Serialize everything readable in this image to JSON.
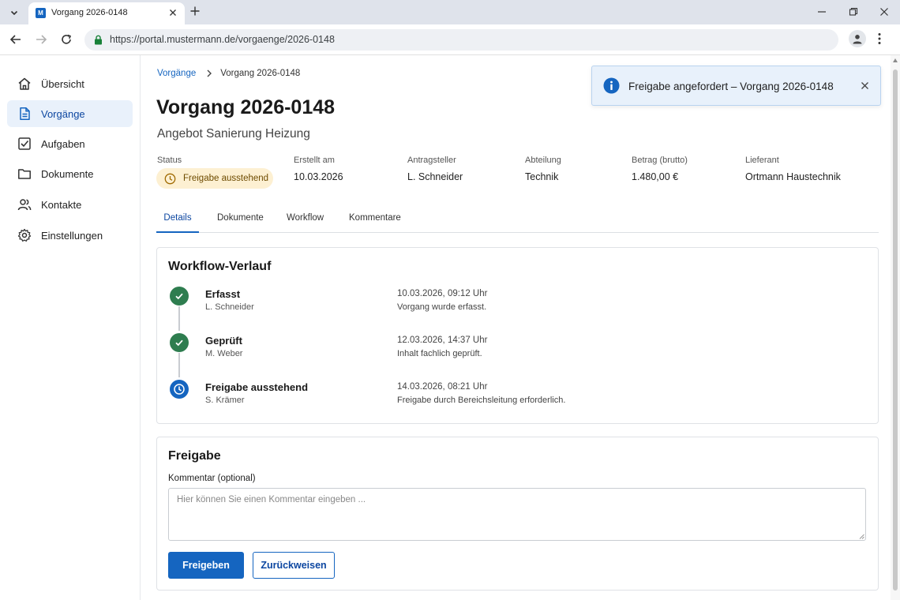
{
  "browser": {
    "tab_title": "Vorgang 2026-0148",
    "favicon_text": "M",
    "url": "https://portal.mustermann.de/vorgaenge/2026-0148"
  },
  "sidebar": {
    "items": [
      {
        "label": "Übersicht",
        "icon": "home-icon"
      },
      {
        "label": "Vorgänge",
        "icon": "document-icon",
        "active": true
      },
      {
        "label": "Aufgaben",
        "icon": "checkbox-icon"
      },
      {
        "label": "Dokumente",
        "icon": "folder-icon"
      },
      {
        "label": "Kontakte",
        "icon": "contacts-icon"
      },
      {
        "label": "Einstellungen",
        "icon": "gear-icon"
      }
    ]
  },
  "breadcrumb": {
    "parent": "Vorgänge",
    "current": "Vorgang 2026-0148"
  },
  "header": {
    "title": "Vorgang 2026-0148",
    "subtitle": "Angebot Sanierung Heizung"
  },
  "meta": {
    "status_label": "Status",
    "status_value": "Freigabe ausstehend",
    "created_label": "Erstellt am",
    "created_value": "10.03.2026",
    "applicant_label": "Antragsteller",
    "applicant_value": "L. Schneider",
    "department_label": "Abteilung",
    "department_value": "Technik",
    "amount_label": "Betrag (brutto)",
    "amount_value": "1.480,00 €",
    "supplier_label": "Lieferant",
    "supplier_value": "Ortmann Haustechnik"
  },
  "tabs": [
    {
      "label": "Details",
      "active": true
    },
    {
      "label": "Dokumente"
    },
    {
      "label": "Workflow"
    },
    {
      "label": "Kommentare"
    }
  ],
  "workflow": {
    "title": "Workflow-Verlauf",
    "steps": [
      {
        "name": "Erfasst",
        "person": "L. Schneider",
        "timestamp": "10.03.2026, 09:12 Uhr",
        "note": "Vorgang wurde erfasst.",
        "state": "done"
      },
      {
        "name": "Geprüft",
        "person": "M. Weber",
        "timestamp": "12.03.2026, 14:37 Uhr",
        "note": "Inhalt fachlich geprüft.",
        "state": "done"
      },
      {
        "name": "Freigabe ausstehend",
        "person": "S. Krämer",
        "timestamp": "14.03.2026, 08:21 Uhr",
        "note": "Freigabe durch Bereichsleitung erforderlich.",
        "state": "pending"
      }
    ]
  },
  "approval": {
    "title": "Freigabe",
    "comment_label": "Kommentar (optional)",
    "comment_value": "",
    "comment_placeholder": "Hier können Sie einen Kommentar eingeben ...",
    "approve_label": "Freigeben",
    "reject_label": "Zurückweisen"
  },
  "toast": {
    "message": "Freigabe angefordert – Vorgang 2026-0148",
    "icon": "info-icon"
  },
  "colors": {
    "accent": "#1565c0",
    "success": "#2e7d4f",
    "warning_bg": "#fdf0d2",
    "warning_text": "#6e4b00",
    "toast_bg": "#e8f1fb"
  }
}
